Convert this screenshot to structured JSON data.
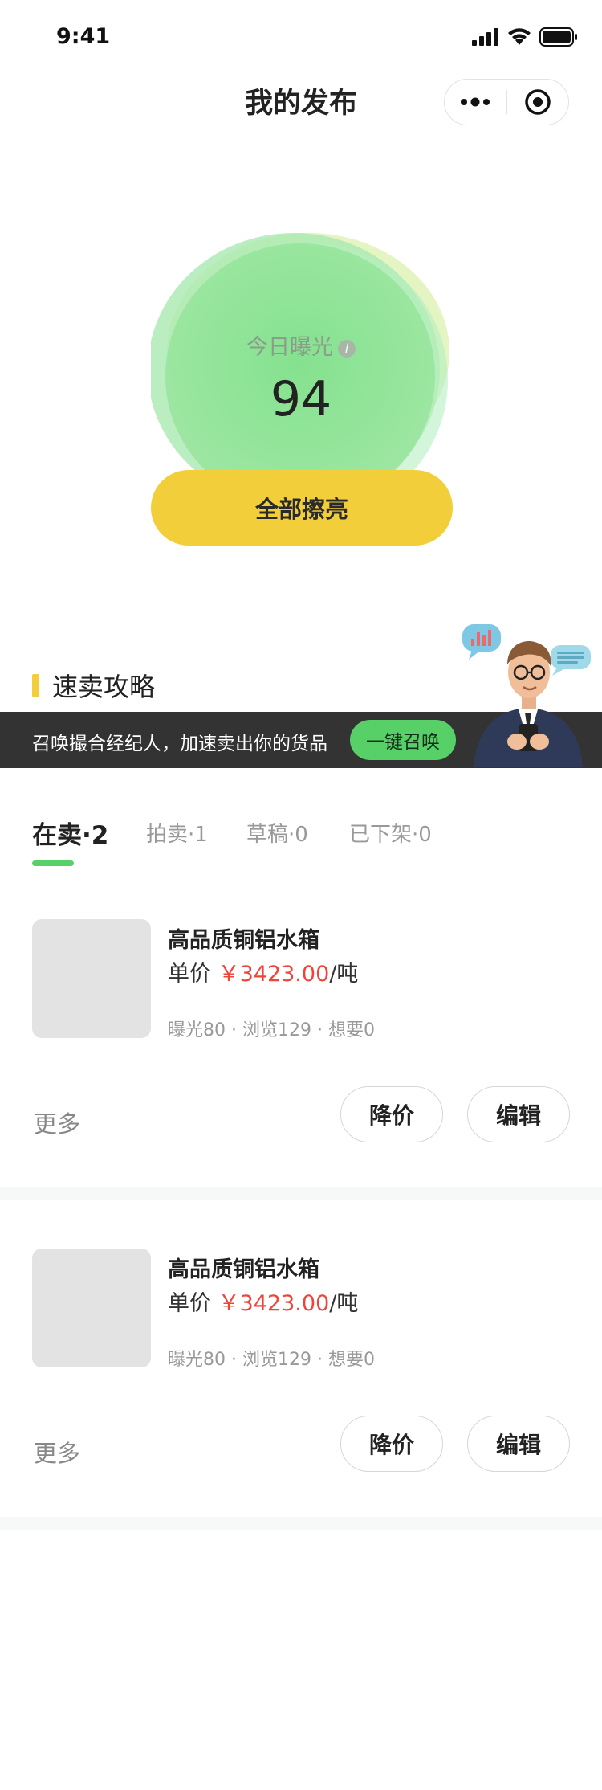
{
  "status_bar": {
    "time": "9:41"
  },
  "nav": {
    "title": "我的发布"
  },
  "exposure": {
    "label": "今日曝光",
    "value": "94",
    "button_label": "全部擦亮"
  },
  "strategy": {
    "title": "速卖攻略",
    "banner_text": "召唤撮合经纪人，加速卖出你的货品",
    "summon_label": "一键召唤"
  },
  "tabs": [
    {
      "label": "在卖·2",
      "active": true
    },
    {
      "label": "拍卖·1",
      "active": false
    },
    {
      "label": "草稿·0",
      "active": false
    },
    {
      "label": "已下架·0",
      "active": false
    }
  ],
  "listings": [
    {
      "name": "高品质铜铝水箱",
      "price_prefix": "单价",
      "price": "￥3423.00",
      "price_unit": "/吨",
      "stats": "曝光80 · 浏览129 · 想要0",
      "more_label": "更多",
      "reduce_label": "降价",
      "edit_label": "编辑"
    },
    {
      "name": "高品质铜铝水箱",
      "price_prefix": "单价",
      "price": "￥3423.00",
      "price_unit": "/吨",
      "stats": "曝光80 · 浏览129 · 想要0",
      "more_label": "更多",
      "reduce_label": "降价",
      "edit_label": "编辑"
    }
  ],
  "colors": {
    "accent_green": "#56d067",
    "accent_yellow": "#f2cf3a",
    "price_red": "#f0443a",
    "banner_dark": "#333333"
  }
}
